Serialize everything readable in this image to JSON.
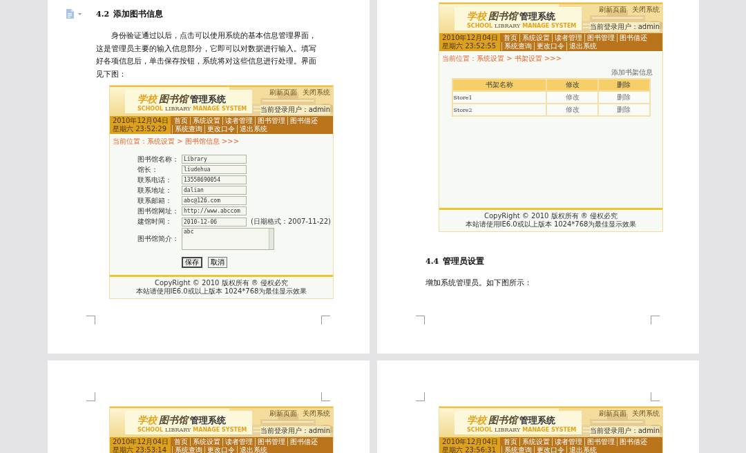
{
  "rows": [
    {
      "pages": [
        {
          "outline_icon": true,
          "blocks": [
            {
              "kind": "heading",
              "number": "4.2",
              "text": "添加图书信息"
            },
            {
              "kind": "paragraph",
              "indent": true,
              "text": "身份验证通过以后，点击可以使用系统的基本信息管理界面，这是管理员主要的输入信息部分，它即可以对数据进行输入。填写好各项信息后，单击保存按钮，系统将对这些信息进行处理。界面见下图："
            },
            {
              "kind": "screenshot",
              "shot": {
                "links": [
                  "刷新页面",
                  "关闭系统"
                ],
                "logo": {
                  "cn_school": "学校",
                  "cn_library": "图书馆",
                  "cn_system": "管理系统",
                  "en_school": "SCHOOL",
                  "en_library": "LIBRARY",
                  "en_system": "MANAGE SYSTEM"
                },
                "user_label": "当前登录用户：",
                "user": "admin",
                "date": "2010年12月04日",
                "weekday_time": "星期六 23:52:29",
                "nav": [
                  "首页",
                  "系统设置",
                  "读者管理",
                  "图书管理",
                  "图书借还",
                  "系统查询",
                  "更改口令",
                  "退出系统"
                ],
                "breadcrumb": "当前位置：系统设置 > 图书馆信息 >>>",
                "body": {
                  "kind": "form",
                  "fields": [
                    {
                      "kind": "text",
                      "label": "图书馆名称：",
                      "value": "Library"
                    },
                    {
                      "kind": "text",
                      "label": "馆长：",
                      "value": "liudehua"
                    },
                    {
                      "kind": "text",
                      "label": "联系电话：",
                      "value": "13558690054"
                    },
                    {
                      "kind": "text",
                      "label": "联系地址：",
                      "value": "dalian"
                    },
                    {
                      "kind": "text",
                      "label": "联系邮箱：",
                      "value": "abc@126.com"
                    },
                    {
                      "kind": "text",
                      "label": "图书馆网址：",
                      "value": "http://www.abccom"
                    },
                    {
                      "kind": "text",
                      "label": "建馆时间：",
                      "value": "2010-12-06",
                      "hint": "(日期格式：2007-11-22)"
                    },
                    {
                      "kind": "textarea",
                      "label": "图书馆简介：",
                      "value": "abc"
                    }
                  ],
                  "buttons": [
                    {
                      "kind": "save",
                      "label": "保存"
                    },
                    {
                      "kind": "cancel",
                      "label": "取消"
                    }
                  ]
                },
                "footer": [
                  "CopyRight © 2010  版权所有 ® 侵权必究",
                  "本站请使用IE6.0或以上版本 1024*768为最佳显示效果"
                ]
              }
            }
          ]
        },
        {
          "blocks": [
            {
              "kind": "screenshot",
              "shot": {
                "links": [
                  "刷新页面",
                  "关闭系统"
                ],
                "logo": {
                  "cn_school": "学校",
                  "cn_library": "图书馆",
                  "cn_system": "管理系统",
                  "en_school": "SCHOOL",
                  "en_library": "LIBRARY",
                  "en_system": "MANAGE SYSTEM"
                },
                "user_label": "当前登录用户：",
                "user": "admin",
                "date": "2010年12月04日",
                "weekday_time": "星期六 23:52:55",
                "nav": [
                  "首页",
                  "系统设置",
                  "读者管理",
                  "图书管理",
                  "图书借还",
                  "系统查询",
                  "更改口令",
                  "退出系统"
                ],
                "breadcrumb": "当前位置：系统设置 > 书架设置 >>>",
                "body": {
                  "kind": "table",
                  "action": "添加书架信息",
                  "columns": [
                    "书架名称",
                    "修改",
                    "删除"
                  ],
                  "rows": [
                    [
                      "Store1",
                      "修改",
                      "删除"
                    ],
                    [
                      "Store2",
                      "修改",
                      "删除"
                    ]
                  ]
                },
                "footer": [
                  "CopyRight © 2010  版权所有 ® 侵权必究",
                  "本站请使用IE6.0或以上版本 1024*768为最佳显示效果"
                ]
              }
            },
            {
              "kind": "heading",
              "number": "4.4",
              "text": "管理员设置"
            },
            {
              "kind": "paragraph",
              "indent": false,
              "text": "增加系统管理员。如下图所示："
            }
          ]
        }
      ]
    },
    {
      "pages": [
        {
          "blocks": [
            {
              "kind": "screenshot",
              "shot": {
                "links": [
                  "刷新页面",
                  "关闭系统"
                ],
                "logo": {
                  "cn_school": "学校",
                  "cn_library": "图书馆",
                  "cn_system": "管理系统",
                  "en_school": "SCHOOL",
                  "en_library": "LIBRARY",
                  "en_system": "MANAGE SYSTEM"
                },
                "user_label": "当前登录用户：",
                "user": "admin",
                "date": "2010年12月04日",
                "weekday_time": "星期六 23:53:14",
                "nav": [
                  "首页",
                  "系统设置",
                  "读者管理",
                  "图书管理",
                  "图书借还",
                  "系统查询",
                  "更改口令",
                  "退出系统"
                ]
              }
            }
          ]
        },
        {
          "blocks": [
            {
              "kind": "screenshot",
              "shot": {
                "links": [
                  "刷新页面",
                  "关闭系统"
                ],
                "logo": {
                  "cn_school": "学校",
                  "cn_library": "图书馆",
                  "cn_system": "管理系统",
                  "en_school": "SCHOOL",
                  "en_library": "LIBRARY",
                  "en_system": "MANAGE SYSTEM"
                },
                "user_label": "当前登录用户：",
                "user": "admin",
                "date": "2010年12月04日",
                "weekday_time": "星期六 23:56:31",
                "nav": [
                  "首页",
                  "系统设置",
                  "读者管理",
                  "图书管理",
                  "图书借还",
                  "系统查询",
                  "更改口令",
                  "退出系统"
                ]
              }
            }
          ]
        }
      ]
    }
  ]
}
